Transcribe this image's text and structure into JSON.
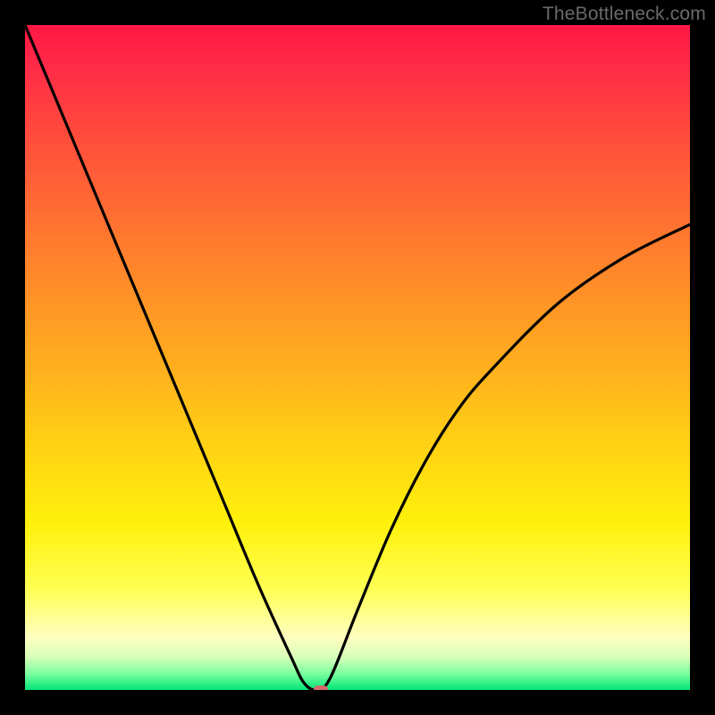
{
  "watermark": "TheBottleneck.com",
  "chart_data": {
    "type": "line",
    "title": "",
    "xlabel": "",
    "ylabel": "",
    "xlim": [
      0,
      1
    ],
    "ylim": [
      0,
      1
    ],
    "series": [
      {
        "name": "bottleneck-curve",
        "x": [
          0.0,
          0.05,
          0.1,
          0.15,
          0.2,
          0.25,
          0.3,
          0.35,
          0.4,
          0.42,
          0.44,
          0.46,
          0.5,
          0.55,
          0.6,
          0.65,
          0.7,
          0.8,
          0.9,
          1.0
        ],
        "values": [
          1.0,
          0.88,
          0.76,
          0.64,
          0.52,
          0.4,
          0.28,
          0.16,
          0.05,
          0.01,
          0.0,
          0.02,
          0.12,
          0.24,
          0.34,
          0.42,
          0.48,
          0.58,
          0.65,
          0.7
        ]
      }
    ],
    "marker": {
      "x": 0.445,
      "y": 0.0
    },
    "colors": {
      "gradient_top": "#ff1744",
      "gradient_bottom": "#00e676",
      "curve": "#000000",
      "marker": "#d46a6a",
      "frame": "#000000"
    }
  }
}
